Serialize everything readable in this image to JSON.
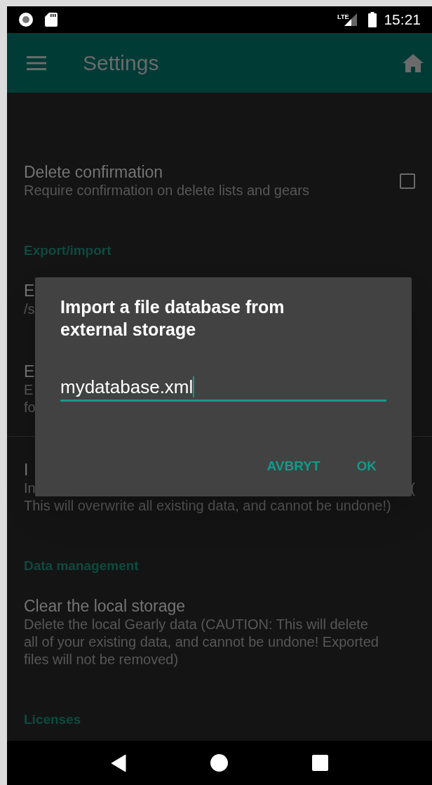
{
  "status_bar": {
    "network": "LTE",
    "time": "15:21"
  },
  "app_bar": {
    "title": "Settings"
  },
  "settings": [
    {
      "kind": "item",
      "title": "Delete confirmation",
      "lines": [
        {
          "text": "Require confirmation on delete lists and gears"
        }
      ],
      "checkbox": {
        "checked": false
      }
    },
    {
      "kind": "header",
      "title": "Export/import"
    },
    {
      "kind": "item",
      "title": "E",
      "lines": [
        {
          "text": "/s"
        }
      ]
    },
    {
      "kind": "item",
      "title": "E",
      "lines": [
        {
          "text": "E"
        },
        {
          "text": "fo"
        }
      ]
    },
    {
      "kind": "item",
      "divider_before": true,
      "title": "I",
      "lines": [
        {
          "text": "In",
          "tail": "("
        },
        {
          "text": "This will overwrite all existing data, and cannot be undone!)"
        }
      ]
    },
    {
      "kind": "header",
      "title": "Data management"
    },
    {
      "kind": "item",
      "title": "Clear the local storage",
      "lines": [
        {
          "text": "Delete the local Gearly data (CAUTION: This will delete"
        },
        {
          "text": "all of your existing data, and cannot be undone! Exported"
        },
        {
          "text": "files will not be removed)"
        }
      ]
    },
    {
      "kind": "header",
      "title": "Licenses"
    }
  ],
  "dialog": {
    "title_lines": [
      "Import a file database from",
      "external storage"
    ],
    "value": "mydatabase.xml",
    "buttons": [
      "AVBRYT",
      "OK"
    ]
  }
}
